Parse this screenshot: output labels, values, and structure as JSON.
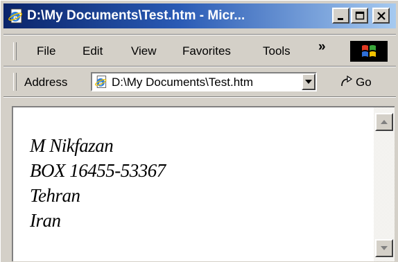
{
  "window": {
    "title": "D:\\My Documents\\Test.htm - Micr...",
    "title_icon": "ie-page-icon"
  },
  "menu": {
    "items": [
      "File",
      "Edit",
      "View",
      "Favorites",
      "Tools"
    ],
    "overflow": "»",
    "logo_icon": "windows-flag-icon"
  },
  "address_bar": {
    "label": "Address",
    "value": "D:\\My Documents\\Test.htm",
    "go_label": "Go"
  },
  "document": {
    "lines": [
      "M Nikfazan",
      "BOX 16455-53367",
      "Tehran",
      "Iran"
    ]
  },
  "colors": {
    "title_start": "#0a246a",
    "title_end": "#a6caf0",
    "chrome": "#d4d0c8"
  }
}
